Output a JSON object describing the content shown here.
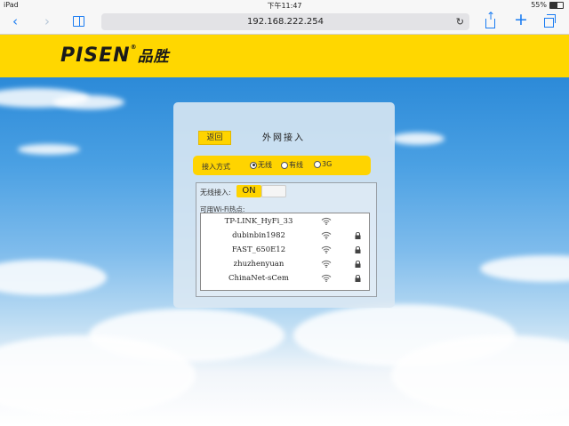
{
  "status_bar": {
    "device": "iPad",
    "time": "下午11:47",
    "battery": "55%"
  },
  "browser": {
    "url": "192.168.222.254"
  },
  "header": {
    "brand": "PISEN",
    "brand_cn": "品胜"
  },
  "panel": {
    "back_label": "返回",
    "title": "外网接入",
    "access_mode": {
      "label": "接入方式",
      "options": [
        "无线",
        "有线",
        "3G"
      ],
      "selected": "无线"
    },
    "wireless": {
      "label": "无线接入:",
      "toggle_state": "ON",
      "hotspots_label": "可用Wi-Fi热点:",
      "networks": [
        {
          "ssid": "TP-LINK_HyFi_33",
          "locked": false
        },
        {
          "ssid": "dubinbin1982",
          "locked": true
        },
        {
          "ssid": "FAST_650E12",
          "locked": true
        },
        {
          "ssid": "zhuzhenyuan",
          "locked": true
        },
        {
          "ssid": "ChinaNet-sCem",
          "locked": true
        }
      ]
    }
  }
}
